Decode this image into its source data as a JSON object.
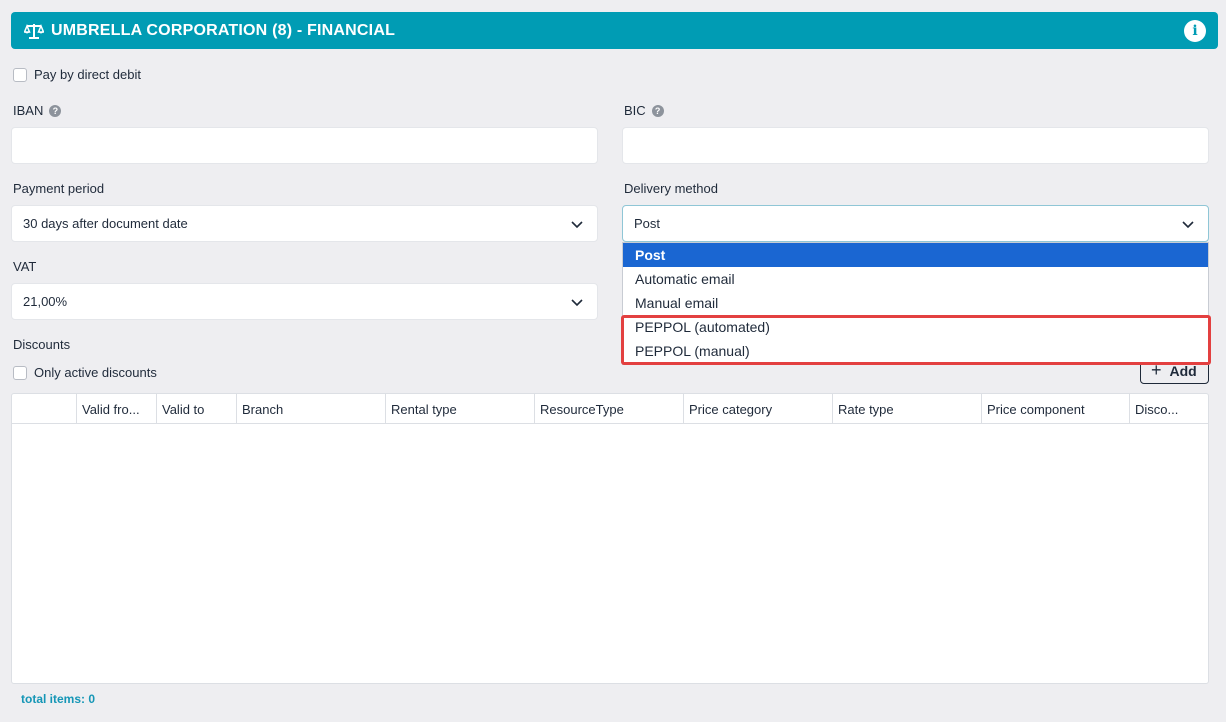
{
  "header": {
    "title": "UMBRELLA CORPORATION (8) - FINANCIAL",
    "icon": "scale-icon",
    "info_icon": "i"
  },
  "direct_debit": {
    "label": "Pay by direct debit",
    "checked": false
  },
  "iban": {
    "label": "IBAN",
    "value": "",
    "help": "?"
  },
  "bic": {
    "label": "BIC",
    "value": "",
    "help": "?"
  },
  "payment_period": {
    "label": "Payment period",
    "value": "30 days after document date"
  },
  "delivery_method": {
    "label": "Delivery method",
    "value": "Post",
    "options": [
      "Post",
      "Automatic email",
      "Manual email",
      "PEPPOL (automated)",
      "PEPPOL (manual)"
    ],
    "selected_index": 0
  },
  "vat": {
    "label": "VAT",
    "value": "21,00%"
  },
  "discounts": {
    "label": "Discounts",
    "only_active_label": "Only active discounts",
    "add_label": "Add",
    "columns": [
      "",
      "Valid fro...",
      "Valid to",
      "Branch",
      "Rental type",
      "ResourceType",
      "Price category",
      "Rate type",
      "Price component",
      "Disco..."
    ],
    "total_label": "total items: 0"
  },
  "colors": {
    "header": "#009cb4",
    "selected_option": "#1a66d2",
    "highlight": "#e34040",
    "total_text": "#1596b6"
  }
}
